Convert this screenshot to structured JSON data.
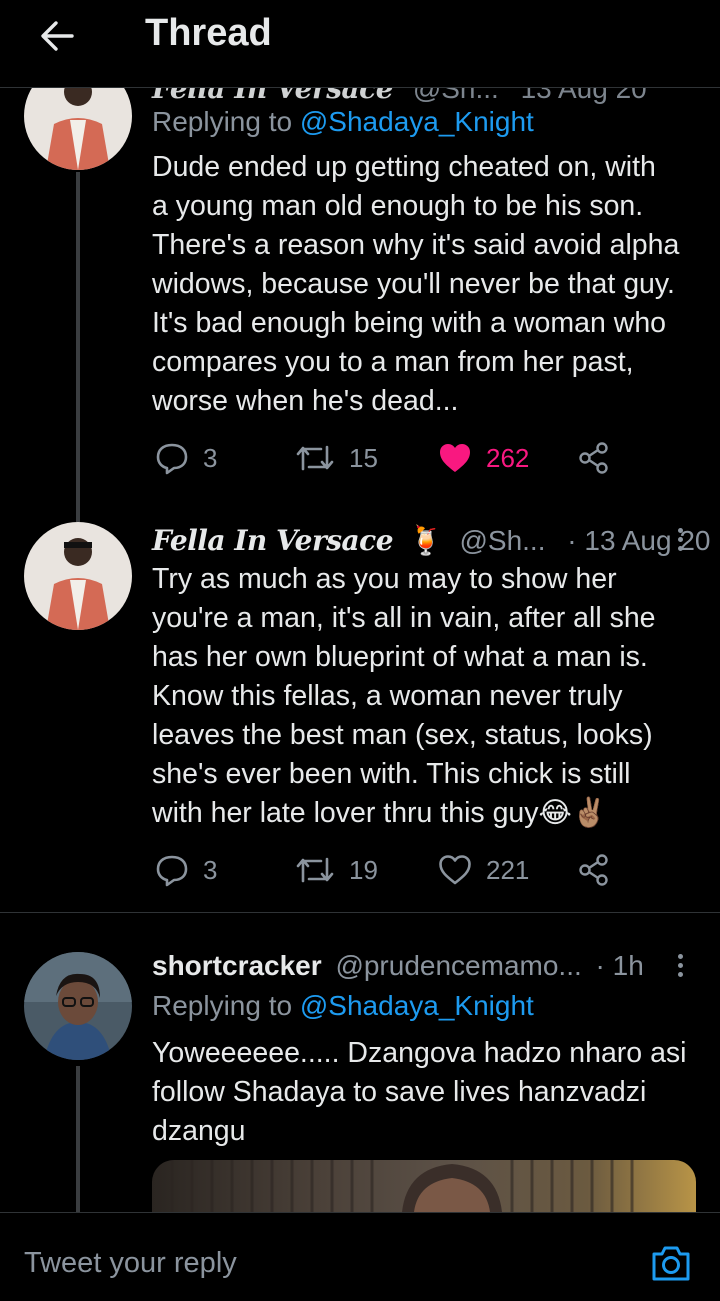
{
  "header": {
    "title": "Thread"
  },
  "tweets": [
    {
      "display_name_partial": "Fella In Versace",
      "handle_partial": "@Sh...",
      "date_partial": "13 Aug 20",
      "replying_label": "Replying to ",
      "replying_to": "@Shadaya_Knight",
      "text": "Dude ended up getting cheated on, with\na young man old enough to be his son.\nThere's a reason why it's said avoid alpha\nwidows, because you'll never be that guy.\nIt's bad enough being with a woman who\ncompares you to a man from her past,\nworse when he's dead...",
      "replies": "3",
      "retweets": "15",
      "likes": "262",
      "liked": true
    },
    {
      "display_name": "Fella In Versace",
      "emoji": "🍹",
      "handle": "@Sh...",
      "date": "· 13 Aug 20",
      "text": "Try as much as you may to show her\nyou're a man, it's all in vain, after all she\nhas her own blueprint of what a man is.\nKnow this fellas, a woman never truly\nleaves the best man (sex, status, looks)\nshe's ever been with. This chick is still\nwith her late lover thru this guy😂✌🏽",
      "replies": "3",
      "retweets": "19",
      "likes": "221",
      "liked": false
    },
    {
      "display_name": "shortcracker",
      "handle": "@prudencemamo...",
      "date": "· 1h",
      "replying_label": "Replying to ",
      "replying_to": "@Shadaya_Knight",
      "text": "Yoweeeeee..... Dzangova hadzo nharo asi\nfollow Shadaya to save lives hanzvadzi\ndzangu"
    }
  ],
  "reply_bar": {
    "placeholder": "Tweet your reply"
  },
  "colors": {
    "background": "#000000",
    "link": "#1d9bf0",
    "like": "#f91880",
    "muted": "#8b949e"
  }
}
